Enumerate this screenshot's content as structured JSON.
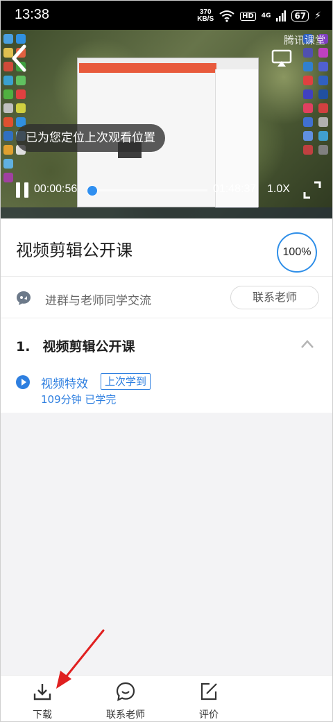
{
  "status_bar": {
    "time": "13:38",
    "net_speed_value": "370",
    "net_speed_unit": "KB/S",
    "hd_badge": "HD",
    "signal_label": "4G",
    "battery": "67"
  },
  "player": {
    "watermark": "腾讯课堂",
    "resume_toast": "已为您定位上次观看位置",
    "current_time": "00:00:56",
    "total_time": "01:48:37",
    "playback_speed": "1.0X",
    "progress_fraction": 0.009
  },
  "course": {
    "title": "视频剪辑公开课",
    "completion": "100%"
  },
  "group": {
    "text": "进群与老师同学交流",
    "contact_button": "联系老师"
  },
  "chapter": {
    "number": "1.",
    "title": "视频剪辑公开课",
    "lesson": {
      "title": "视频特效",
      "badge": "上次学到",
      "meta": "109分钟  已学完"
    }
  },
  "bottom_nav": {
    "download": "下载",
    "contact": "联系老师",
    "review": "评价"
  },
  "colors": {
    "accent": "#2e7fe0",
    "ring": "#2e8ee8",
    "annotation_arrow": "#e02020"
  },
  "icons": [
    "back-icon",
    "cast-icon",
    "pause-icon",
    "fullscreen-icon",
    "chat-icon",
    "chevron-up-icon",
    "play-circle-icon",
    "download-icon",
    "message-smile-icon",
    "edit-icon"
  ]
}
